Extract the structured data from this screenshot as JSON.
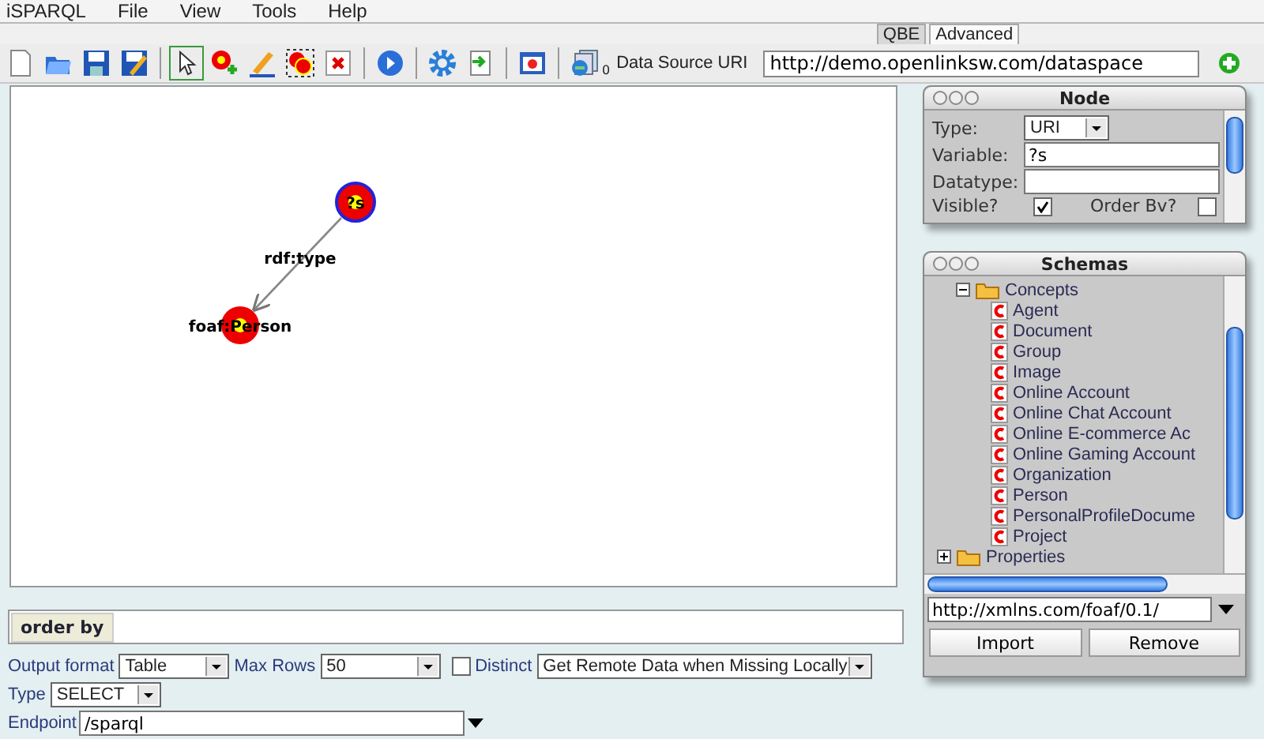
{
  "menu": [
    "iSPARQL",
    "File",
    "View",
    "Tools",
    "Help"
  ],
  "tabs": [
    {
      "label": "QBE",
      "selected": true
    },
    {
      "label": "Advanced",
      "selected": false
    }
  ],
  "toolbar_groups": [
    {
      "tools": [
        {
          "kind": "new",
          "selected": false
        },
        {
          "kind": "open",
          "selected": false
        },
        {
          "kind": "save",
          "selected": false
        },
        {
          "kind": "saveas",
          "selected": false
        }
      ]
    },
    {
      "tools": [
        {
          "kind": "pointer",
          "selected": true
        },
        {
          "kind": "addnode",
          "selected": false
        },
        {
          "kind": "pencil",
          "selected": false
        },
        {
          "kind": "group",
          "selected": false
        },
        {
          "kind": "delete",
          "selected": false
        }
      ]
    },
    {
      "tools": [
        {
          "kind": "run",
          "selected": false
        }
      ]
    },
    {
      "tools": [
        {
          "kind": "gear",
          "selected": false
        },
        {
          "kind": "import",
          "selected": false
        }
      ]
    },
    {
      "tools": [
        {
          "kind": "window",
          "selected": false
        }
      ]
    }
  ],
  "data_source": {
    "badge": "0",
    "label": "Data Source URI",
    "value": "http://demo.openlinksw.com/dataspace"
  },
  "graph": {
    "nodes": [
      {
        "label": "?s",
        "kind": "variable"
      },
      {
        "label": "foaf:Person",
        "kind": "resource"
      }
    ],
    "edges": [
      {
        "label": "rdf:type"
      }
    ]
  },
  "node_panel": {
    "title": "Node",
    "type_label": "Type:",
    "type_value": "URI",
    "variable_label": "Variable:",
    "variable_value": "?s",
    "datatype_label": "Datatype:",
    "visible_label": "Visible?",
    "visible_checked": true,
    "order_label": "Order Bv?",
    "order_checked": false
  },
  "schemas_panel": {
    "title": "Schemas",
    "tree": [
      {
        "label": "Concepts",
        "expanded": true,
        "children": [
          {
            "label": "Agent"
          },
          {
            "label": "Document"
          },
          {
            "label": "Group"
          },
          {
            "label": "Image"
          },
          {
            "label": "Online Account"
          },
          {
            "label": "Online Chat Account"
          },
          {
            "label": "Online E-commerce Ac"
          },
          {
            "label": "Online Gaming Account"
          },
          {
            "label": "Organization"
          },
          {
            "label": "Person"
          },
          {
            "label": "PersonalProfileDocume"
          },
          {
            "label": "Project"
          }
        ]
      },
      {
        "label": "Properties",
        "expanded": false
      }
    ],
    "uri": "http://xmlns.com/foaf/0.1/",
    "buttons": [
      "Import",
      "Remove"
    ]
  },
  "order_by": {
    "label": "order by"
  },
  "options": {
    "output_label": "Output format",
    "output_value": "Table",
    "max_rows_label": "Max Rows",
    "max_rows_value": "50",
    "distinct_label": "Distinct",
    "distinct_checked": false,
    "remote_value": "Get Remote Data when Missing Locally",
    "type_label": "Type",
    "type_value": "SELECT",
    "endpoint_label": "Endpoint",
    "endpoint_value": "/sparql"
  }
}
